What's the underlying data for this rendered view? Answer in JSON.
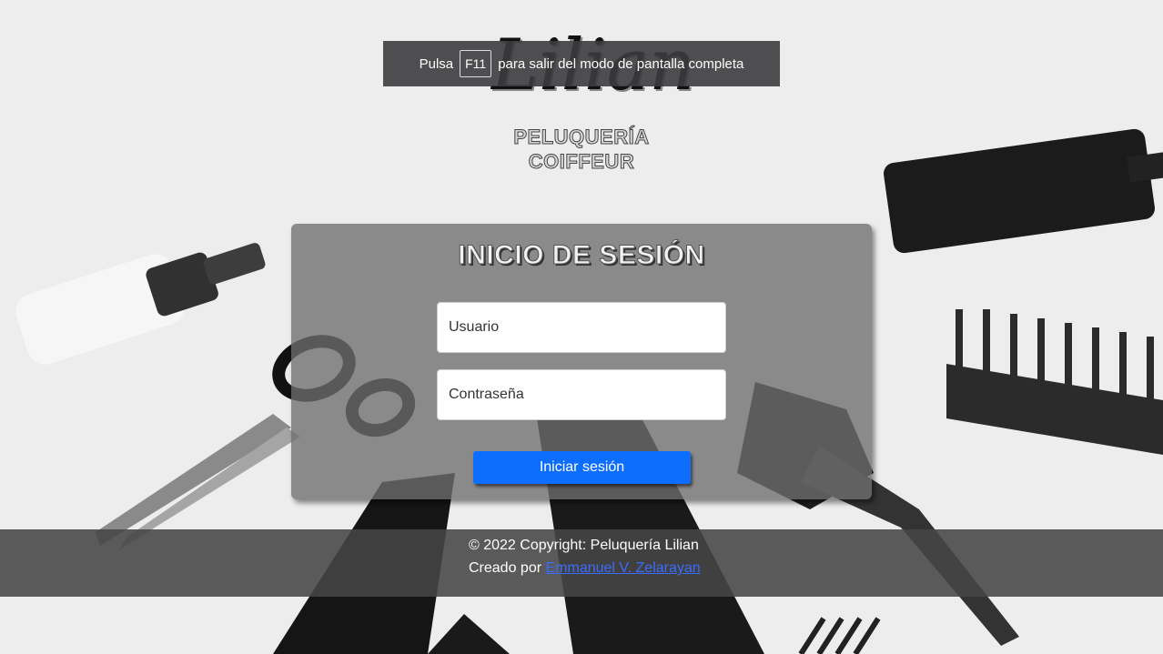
{
  "fullscreen_banner": {
    "prefix": "Pulsa",
    "key": "F11",
    "suffix": "para salir del modo de pantalla completa"
  },
  "logo": {
    "script_name": "Lilian",
    "line1": "PELUQUERÍA",
    "line2": "COIFFEUR"
  },
  "login": {
    "title": "INICIO DE SESIÓN",
    "username_placeholder": "Usuario",
    "password_placeholder": "Contraseña",
    "submit_label": "Iniciar sesión"
  },
  "footer": {
    "copyright": "© 2022 Copyright: Peluquería Lilian",
    "created_by_prefix": "Creado por",
    "author_link": "Emmanuel V. Zelarayan"
  },
  "colors": {
    "primary_button": "#0d6efd",
    "link": "#3b6cff"
  }
}
